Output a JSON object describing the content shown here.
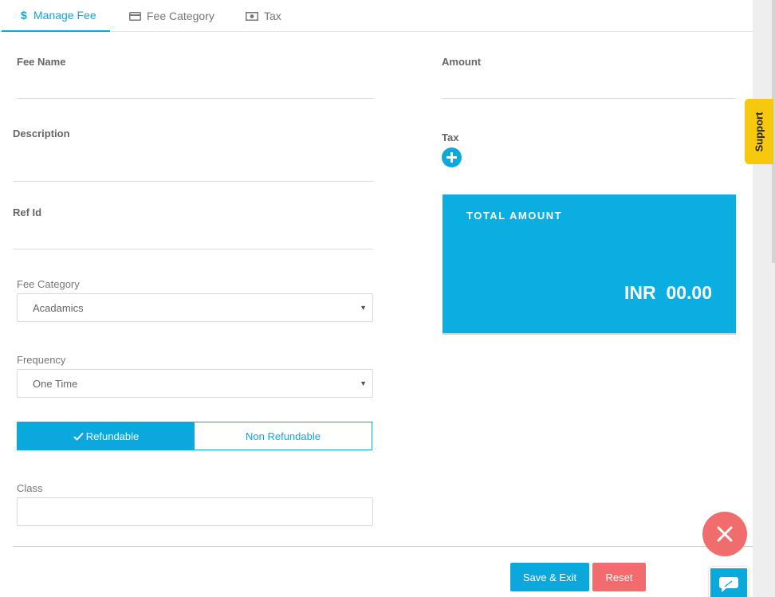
{
  "tabs": [
    {
      "label": "Manage Fee",
      "icon": "dollar-icon",
      "active": true
    },
    {
      "label": "Fee Category",
      "icon": "card-icon",
      "active": false
    },
    {
      "label": "Tax",
      "icon": "money-icon",
      "active": false
    }
  ],
  "form": {
    "fee_name_label": "Fee Name",
    "fee_name_value": "",
    "description_label": "Description",
    "description_value": "",
    "ref_id_label": "Ref Id",
    "ref_id_value": "",
    "fee_category_label": "Fee Category",
    "fee_category_selected": "Acadamics",
    "frequency_label": "Frequency",
    "frequency_selected": "One Time",
    "refundable_label": "Refundable",
    "non_refundable_label": "Non Refundable",
    "refund_selected": "Refundable",
    "class_label": "Class",
    "class_value": "",
    "amount_label": "Amount",
    "amount_value": "",
    "tax_label": "Tax"
  },
  "total": {
    "title": "TOTAL AMOUNT",
    "currency": "INR",
    "value": "00.00"
  },
  "actions": {
    "save_exit": "Save & Exit",
    "reset": "Reset"
  },
  "support_label": "Support",
  "colors": {
    "accent": "#0aa8dc",
    "danger": "#f26c6f",
    "support": "#f6c90e"
  }
}
